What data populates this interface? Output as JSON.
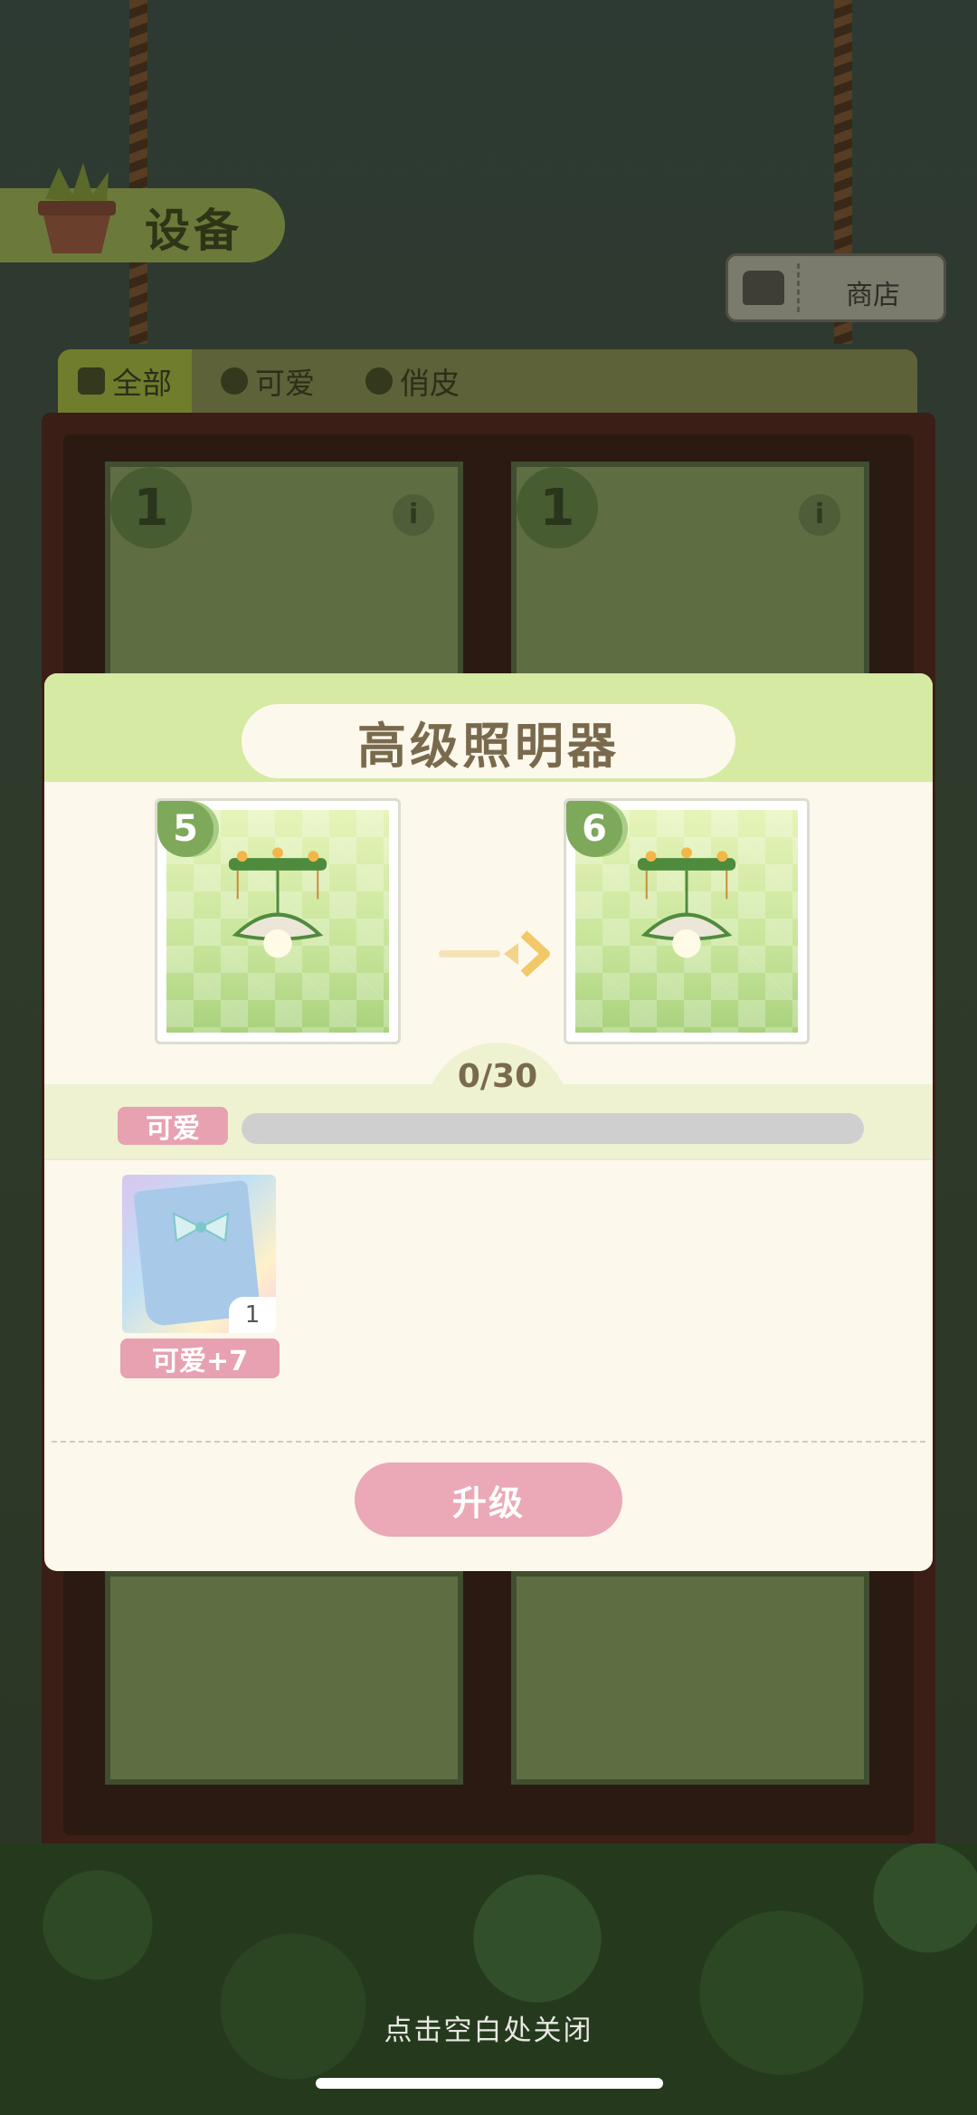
{
  "header": {
    "title": "设备"
  },
  "shop": {
    "label": "商店"
  },
  "tabs": [
    {
      "label": "全部",
      "active": true
    },
    {
      "label": "可爱",
      "active": false
    },
    {
      "label": "俏皮",
      "active": false
    }
  ],
  "background_cards": [
    {
      "level": "1"
    },
    {
      "level": "1"
    }
  ],
  "modal": {
    "title": "高级照明器",
    "current_level": "5",
    "next_level": "6",
    "progress_text": "0/30",
    "progress_fraction": 0,
    "attribute_tag": "可爱",
    "material": {
      "count": "1",
      "bonus_label": "可爱+7"
    },
    "upgrade_label": "升级"
  },
  "footer": {
    "close_hint": "点击空白处关闭"
  },
  "colors": {
    "accent_pink": "#e7a1b0",
    "header_green": "#d5eaa3",
    "panel_cream": "#fdf8ec"
  }
}
